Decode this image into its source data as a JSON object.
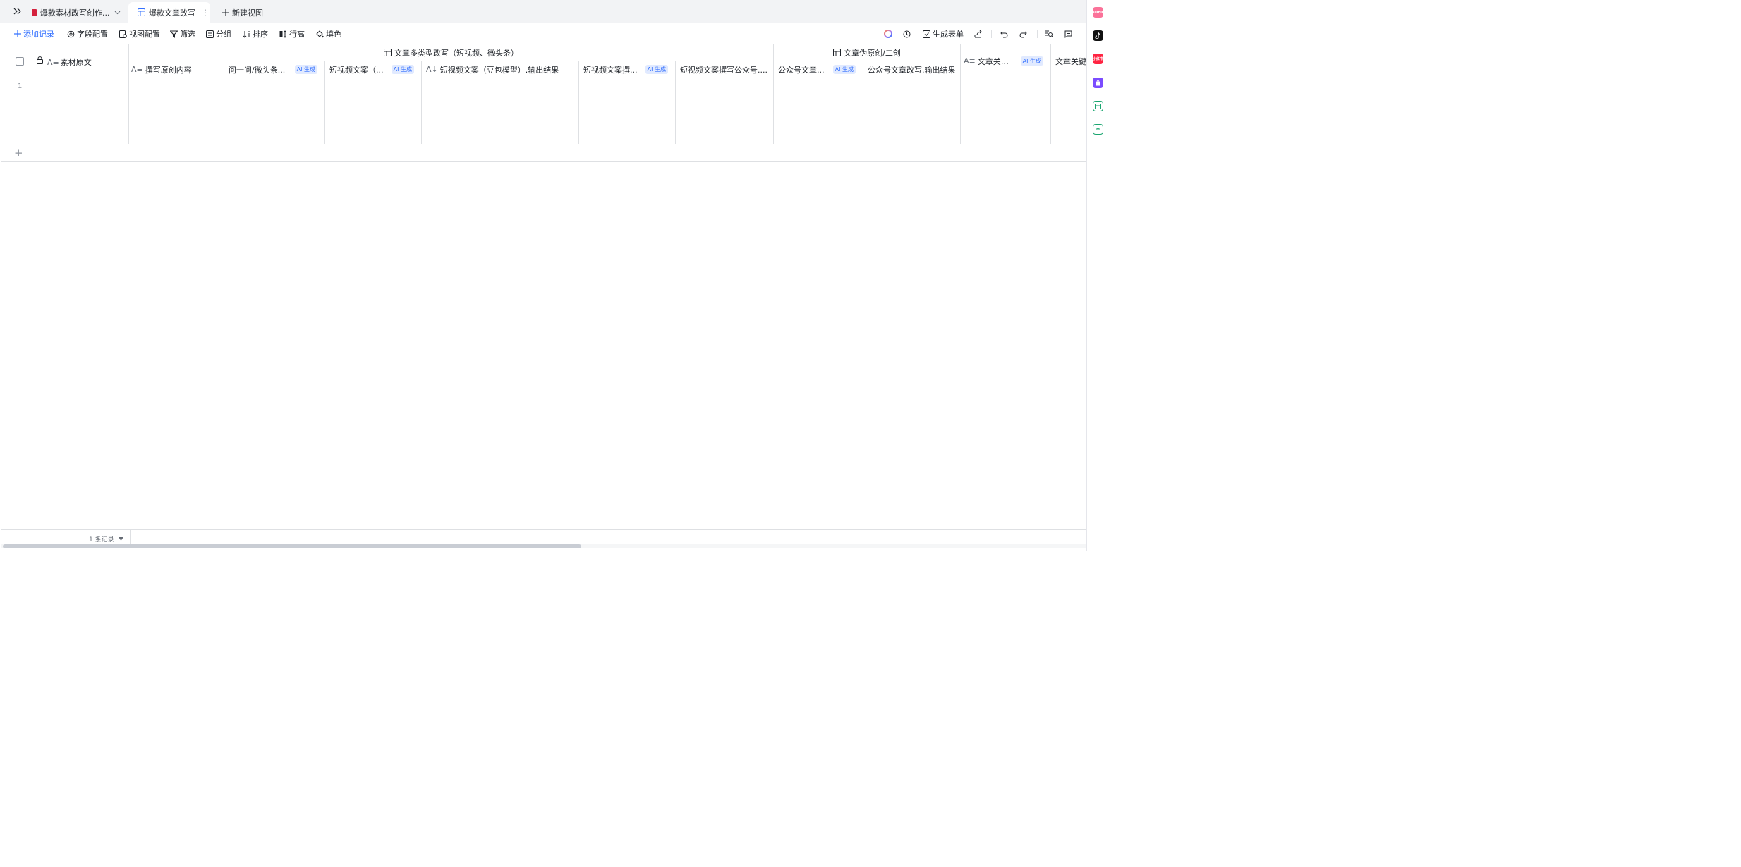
{
  "tabs": {
    "base_name": "爆款素材改写创作...",
    "active_view": "爆款文章改写",
    "new_view": "新建视图"
  },
  "toolbar": {
    "add_record": "添加记录",
    "field_config": "字段配置",
    "view_config": "视图配置",
    "filter": "筛选",
    "group": "分组",
    "sort": "排序",
    "row_height": "行高",
    "fill_color": "填色",
    "generate_form": "生成表单"
  },
  "grid": {
    "frozen_column": "素材原文",
    "groups": {
      "rewrite": "文章多类型改写（短视频、微头条）",
      "original": "文章伪原创/二创"
    },
    "columns": [
      "撰写原创内容",
      "问一问/微头条...",
      "短视频文案（...",
      "短视频文案（豆包模型）.输出结果",
      "短视频文案撰...",
      "短视频文案撰写公众号....",
      "公众号文章...",
      "公众号文章改写.输出结果",
      "文章关键词",
      "文章关键"
    ],
    "ai_badge": "AI 生成",
    "row_number": "1",
    "add_row": "+"
  },
  "footer": {
    "record_count": "1 条记录"
  },
  "rail": {
    "bilibili": "bilibili",
    "xiaohongshu": "小红书",
    "m": "M"
  }
}
